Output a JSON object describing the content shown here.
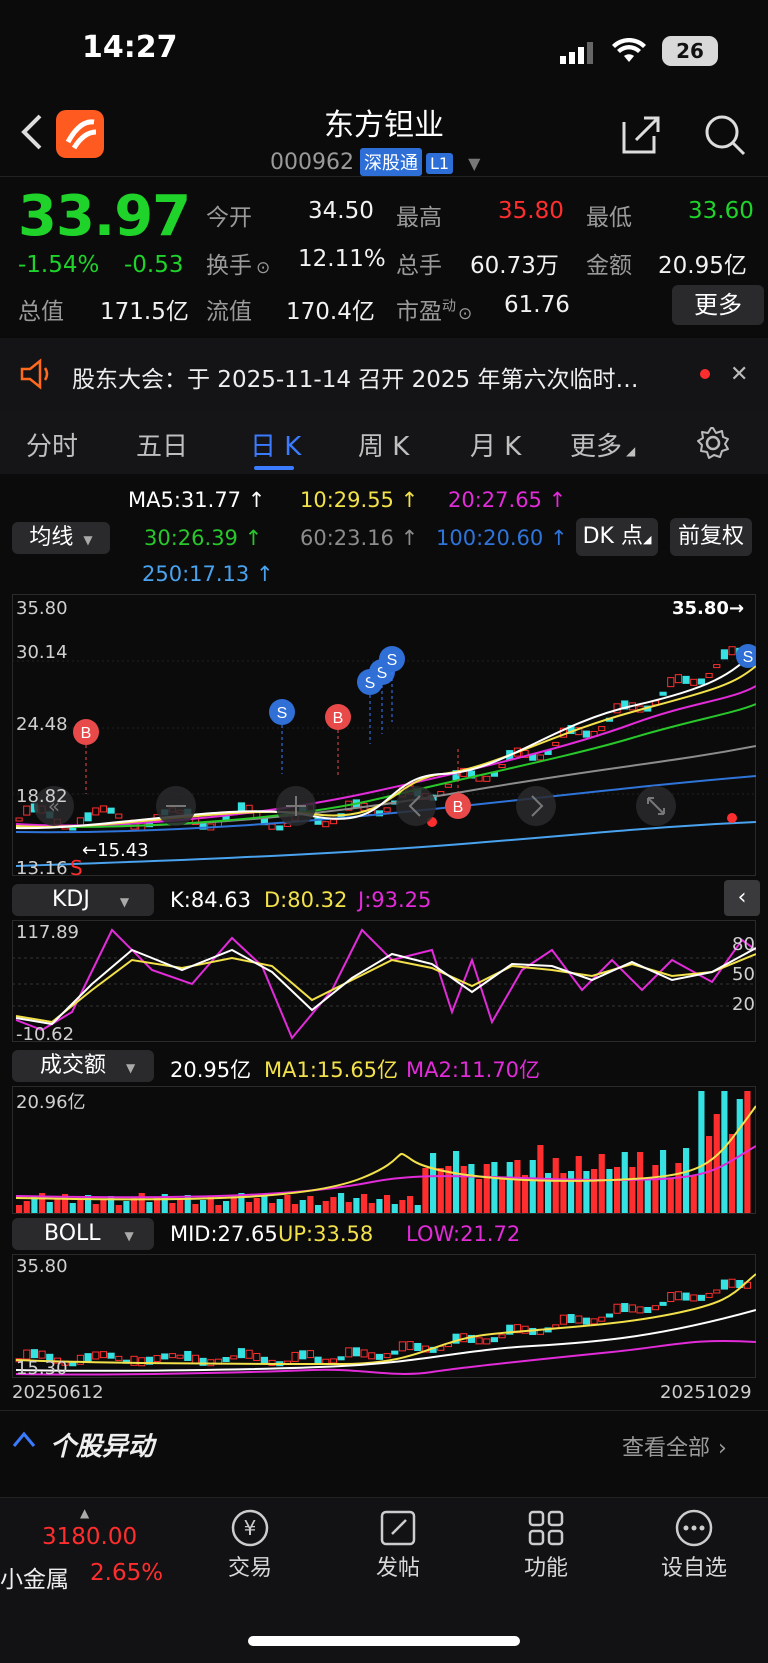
{
  "status": {
    "time": "14:27",
    "battery": "26"
  },
  "header": {
    "title": "东方钽业",
    "code": "000962",
    "exchange_tag": "深股通",
    "level_tag": "L1"
  },
  "quote": {
    "price": "33.97",
    "change_pct": "-1.54%",
    "change": "-0.53",
    "open_label": "今开",
    "open": "34.50",
    "high_label": "最高",
    "high": "35.80",
    "low_label": "最低",
    "low": "33.60",
    "turnover_label": "换手",
    "turnover": "12.11%",
    "volume_label": "总手",
    "volume": "60.73万",
    "amount_label": "金额",
    "amount": "20.95亿",
    "mktcap_label": "总值",
    "mktcap": "171.5亿",
    "float_label": "流值",
    "float": "170.4亿",
    "pe_label": "市盈",
    "pe_sup": "动",
    "pe": "61.76",
    "more_label": "更多"
  },
  "notice": {
    "text": "股东大会：于 2025-11-14 召开 2025 年第六次临时…"
  },
  "tabs": [
    "分时",
    "五日",
    "日 K",
    "周 K",
    "月 K",
    "更多"
  ],
  "active_tab": "日 K",
  "ma_panel": {
    "selector": "均线",
    "dk_button": "DK 点",
    "adjust_button": "前复权",
    "ma5": "MA5:31.77 ↑",
    "ma10": "10:29.55 ↑",
    "ma20": "20:27.65 ↑",
    "ma30": "30:26.39 ↑",
    "ma60": "60:23.16 ↑",
    "ma100": "100:20.60 ↑",
    "ma250": "250:17.13 ↑"
  },
  "kline": {
    "y_ticks": [
      "35.80",
      "30.14",
      "24.48",
      "18.82",
      "13.16"
    ],
    "max_label": "35.80",
    "min_label": "15.43",
    "buy_label": "B",
    "sell_label": "S"
  },
  "kdj": {
    "selector": "KDJ",
    "k": "K:84.63",
    "d": "D:80.32",
    "j": "J:93.25",
    "top": "117.89",
    "bottom": "-10.62",
    "levels": [
      "80",
      "50",
      "20"
    ]
  },
  "volume": {
    "selector": "成交额",
    "value": "20.95亿",
    "ma1": "MA1:15.65亿",
    "ma2": "MA2:11.70亿",
    "top": "20.96亿"
  },
  "boll": {
    "selector": "BOLL",
    "mid": "MID:27.65",
    "up": "UP:33.58",
    "low": "LOW:21.72",
    "top": "35.80",
    "bottom": "15.30",
    "start_date": "20250612",
    "end_date": "20251029"
  },
  "movement": {
    "title": "个股异动",
    "view_all": "查看全部"
  },
  "bottom_nav": {
    "index_value": "3180.00",
    "index_name": "小金属",
    "index_change": "2.65%",
    "items": [
      "交易",
      "发帖",
      "功能",
      "设自选"
    ]
  },
  "colors": {
    "up": "#ff2e2e",
    "down": "#1fd32a",
    "cyan": "#35e1e1",
    "accent": "#3a7bff",
    "ma5": "#ffffff",
    "ma10": "#f2e14a",
    "ma20": "#e22bd9",
    "ma30": "#28c82a",
    "ma60": "#8c8c8c",
    "ma100": "#2f74d9",
    "ma250": "#4aa3ef"
  }
}
